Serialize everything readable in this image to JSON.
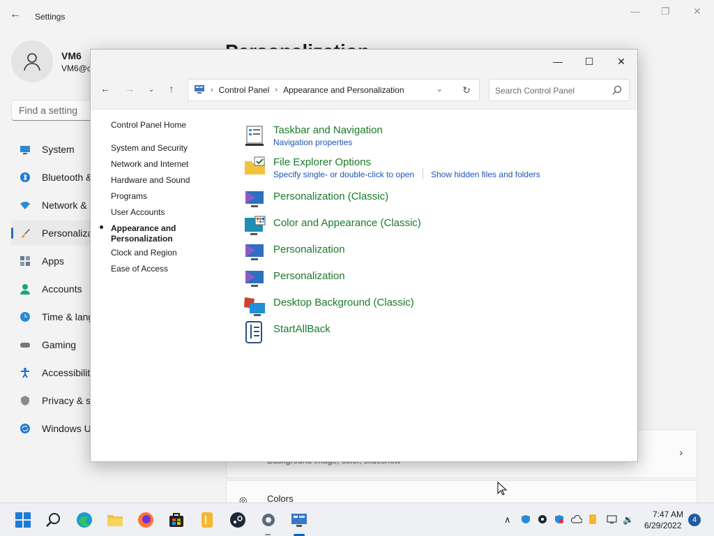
{
  "settings": {
    "title": "Settings",
    "user": {
      "name": "VM6",
      "email": "VM6@c"
    },
    "search_placeholder": "Find a setting",
    "heading": "Personalization",
    "nav": [
      {
        "label": "System",
        "icon": "monitor-icon"
      },
      {
        "label": "Bluetooth &",
        "icon": "bluetooth-icon"
      },
      {
        "label": "Network &",
        "icon": "wifi-icon"
      },
      {
        "label": "Personaliza",
        "icon": "brush-icon"
      },
      {
        "label": "Apps",
        "icon": "apps-icon"
      },
      {
        "label": "Accounts",
        "icon": "person-icon"
      },
      {
        "label": "Time & lang",
        "icon": "clock-icon"
      },
      {
        "label": "Gaming",
        "icon": "gamepad-icon"
      },
      {
        "label": "Accessibilit",
        "icon": "accessibility-icon"
      },
      {
        "label": "Privacy & se",
        "icon": "shield-icon"
      },
      {
        "label": "Windows U",
        "icon": "update-icon"
      }
    ],
    "cards": {
      "background_sub": "Background image, color, slideshow",
      "colors_title": "Colors"
    }
  },
  "control_panel": {
    "breadcrumb": [
      "Control Panel",
      "Appearance and Personalization"
    ],
    "search_placeholder": "Search Control Panel",
    "left_nav": {
      "home": "Control Panel Home",
      "items": [
        "System and Security",
        "Network and Internet",
        "Hardware and Sound",
        "Programs",
        "User Accounts"
      ],
      "current_line1": "Appearance and",
      "current_line2": "Personalization",
      "after": [
        "Clock and Region",
        "Ease of Access"
      ]
    },
    "items": [
      {
        "title": "Taskbar and Navigation",
        "links": [
          "Navigation properties"
        ],
        "icon": "taskbar-icon"
      },
      {
        "title": "File Explorer Options",
        "links": [
          "Specify single- or double-click to open",
          "Show hidden files and folders"
        ],
        "icon": "folder-options-icon"
      },
      {
        "title": "Personalization (Classic)",
        "links": [],
        "icon": "personalization-icon"
      },
      {
        "title": "Color and Appearance (Classic)",
        "links": [],
        "icon": "color-appearance-icon"
      },
      {
        "title": "Personalization",
        "links": [],
        "icon": "personalization-icon"
      },
      {
        "title": "Personalization",
        "links": [],
        "icon": "personalization-icon"
      },
      {
        "title": "Desktop Background (Classic)",
        "links": [],
        "icon": "desktop-background-icon"
      },
      {
        "title": "StartAllBack",
        "links": [],
        "icon": "startallback-icon"
      }
    ]
  },
  "taskbar": {
    "time": "7:47 AM",
    "date": "6/29/2022",
    "notification_count": "4",
    "accent": "#0067c0"
  }
}
